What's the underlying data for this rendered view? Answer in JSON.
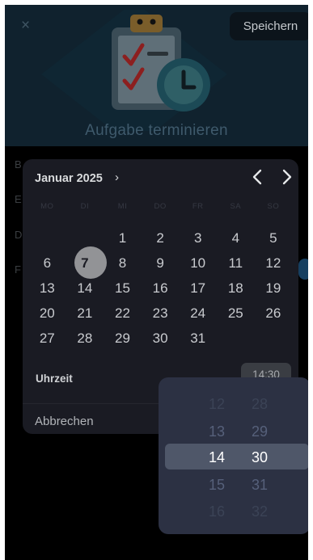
{
  "header": {
    "close_glyph": "×",
    "save_label": "Speichern",
    "title": "Aufgabe terminieren"
  },
  "background_rows": [
    "B",
    "E",
    "D",
    "F"
  ],
  "calendar": {
    "month_label": "Januar 2025",
    "month_chevron": "›",
    "weekdays": [
      "MO",
      "DI",
      "MI",
      "DO",
      "FR",
      "SA",
      "SO"
    ],
    "weeks": [
      [
        "",
        "",
        "1",
        "2",
        "3",
        "4",
        "5"
      ],
      [
        "6",
        "7",
        "8",
        "9",
        "10",
        "11",
        "12"
      ],
      [
        "13",
        "14",
        "15",
        "16",
        "17",
        "18",
        "19"
      ],
      [
        "20",
        "21",
        "22",
        "23",
        "24",
        "25",
        "26"
      ],
      [
        "27",
        "28",
        "29",
        "30",
        "31",
        "",
        ""
      ]
    ],
    "selected_day": "7",
    "time_label": "Uhrzeit",
    "time_value": "14:30",
    "cancel_label": "Abbrechen"
  },
  "time_wheel": {
    "hours": [
      "12",
      "13",
      "14",
      "15",
      "16"
    ],
    "minutes": [
      "28",
      "29",
      "30",
      "31",
      "32"
    ],
    "selected_hour": "14",
    "selected_minute": "30"
  },
  "colors": {
    "header_bg": "#10222e",
    "picker_bg": "#1a1b23",
    "wheel_bg": "#2c3143",
    "selected_day_disc": "#929396",
    "accent": "#1f4f66"
  },
  "icons": [
    "close-icon",
    "clipboard-checklist-icon",
    "clock-icon",
    "chevron-right-icon",
    "chevron-left-icon"
  ]
}
